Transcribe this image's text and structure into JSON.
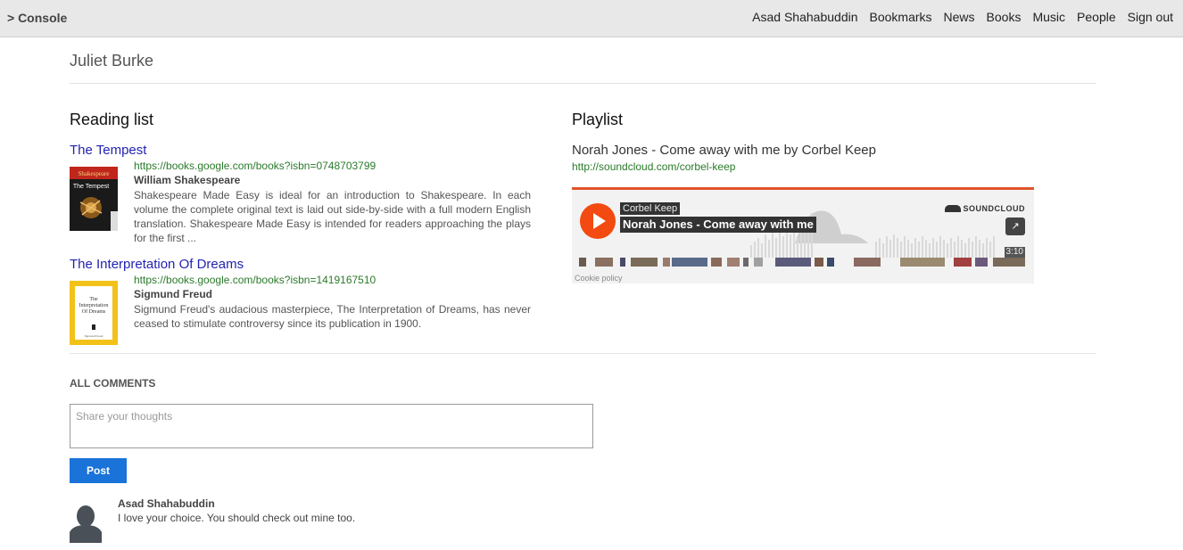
{
  "nav": {
    "brand": "> Console",
    "links": [
      "Asad Shahabuddin",
      "Bookmarks",
      "News",
      "Books",
      "Music",
      "People",
      "Sign out"
    ]
  },
  "profile": {
    "name": "Juliet Burke"
  },
  "reading_list": {
    "title": "Reading list",
    "books": [
      {
        "title": "The Tempest",
        "url": "https://books.google.com/books?isbn=0748703799",
        "author": "William Shakespeare",
        "description": "Shakespeare Made Easy is ideal for an introduction to Shakespeare. In each volume the complete original text is laid out side-by-side with a full modern English translation. Shakespeare Made Easy is intended for readers approaching the plays for the first ...",
        "cover_top": "Shakespeare",
        "cover_label": "The Tempest"
      },
      {
        "title": "The Interpretation Of Dreams",
        "url": "https://books.google.com/books?isbn=1419167510",
        "author": "Sigmund Freud",
        "description": "Sigmund Freud's audacious masterpiece, The Interpretation of Dreams, has never ceased to stimulate controversy since its publication in 1900.",
        "cover_label": "The Interpretation Of Dreams",
        "cover_bottom": "Sigmund Freud"
      }
    ]
  },
  "playlist": {
    "title": "Playlist",
    "track_title": "Norah Jones - Come away with me by Corbel Keep",
    "track_url": "http://soundcloud.com/corbel-keep",
    "player": {
      "artist": "Corbel Keep",
      "track": "Norah Jones - Come away with me",
      "brand": "SOUNDCLOUD",
      "duration": "3:10",
      "cookie": "Cookie policy",
      "accent_color": "#f24a10"
    }
  },
  "comments": {
    "heading": "ALL COMMENTS",
    "placeholder": "Share your thoughts",
    "post_label": "Post",
    "items": [
      {
        "author": "Asad Shahabuddin",
        "text": "I love your choice. You should check out mine too."
      }
    ]
  }
}
